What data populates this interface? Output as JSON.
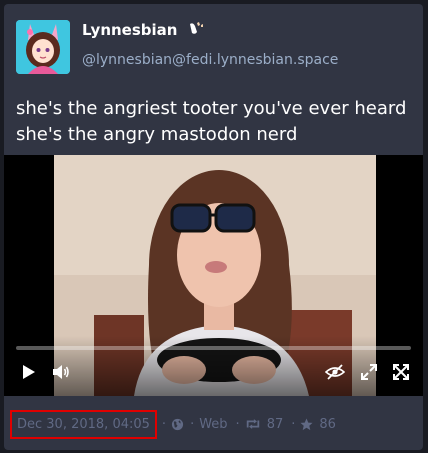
{
  "account": {
    "display_name": "Lynnesbian",
    "handle": "@lynnesbian@fedi.lynnesbian.space",
    "avatar_icon": "anime-avatar-icon",
    "emoji_icon": "custom-emoji-icon"
  },
  "status": {
    "lines": [
      "she's the angriest tooter you've ever heard",
      "she's the angry mastodon nerd"
    ]
  },
  "video": {
    "progress_fraction": 0.0,
    "icons": [
      "play-icon",
      "volume-icon",
      "hide-media-icon",
      "expand-icon",
      "fullscreen-icon"
    ]
  },
  "footer": {
    "timestamp": "Dec 30, 2018, 04:05",
    "separator": "·",
    "visibility_icon": "globe-icon",
    "application": "Web",
    "boost_icon": "boost-icon",
    "boosts": "87",
    "favourite_icon": "star-icon",
    "favourites": "86",
    "highlight_color": "#e00000"
  },
  "colors": {
    "card_bg": "#313543",
    "page_bg": "#191b22",
    "muted_text": "#606984",
    "handle_text": "#9baec8"
  }
}
